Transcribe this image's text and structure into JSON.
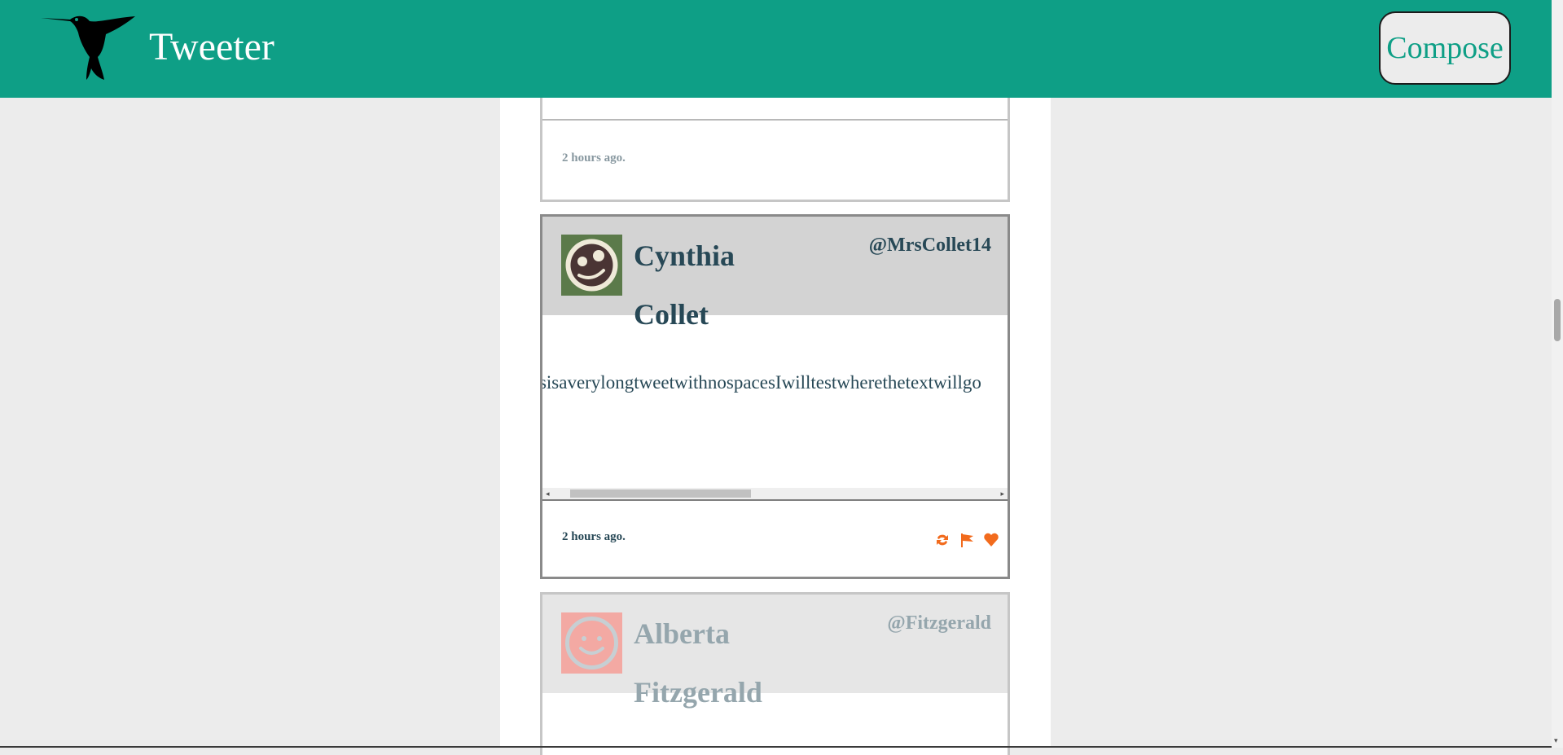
{
  "header": {
    "brand": "Tweeter",
    "compose_label": "Compose",
    "logo_icon": "hummingbird-icon"
  },
  "tweets": [
    {
      "time": "2 hours ago."
    },
    {
      "name": "Cynthia Collet",
      "handle": "@MrsCollet14",
      "text": "ThisisaverylongtweetwithnospacesIwilltestwherethetextwillgo",
      "time": "2 hours ago.",
      "avatar_icon": "face-avatar-icon",
      "actions": [
        "retweet-icon",
        "flag-icon",
        "heart-icon"
      ]
    },
    {
      "name": "Alberta Fitzgerald",
      "handle": "@Fitzgerald",
      "avatar_icon": "smiley-avatar-icon"
    }
  ],
  "colors": {
    "header_bg": "#0e9f86",
    "accent": "#f26b1d",
    "text": "#274856"
  }
}
